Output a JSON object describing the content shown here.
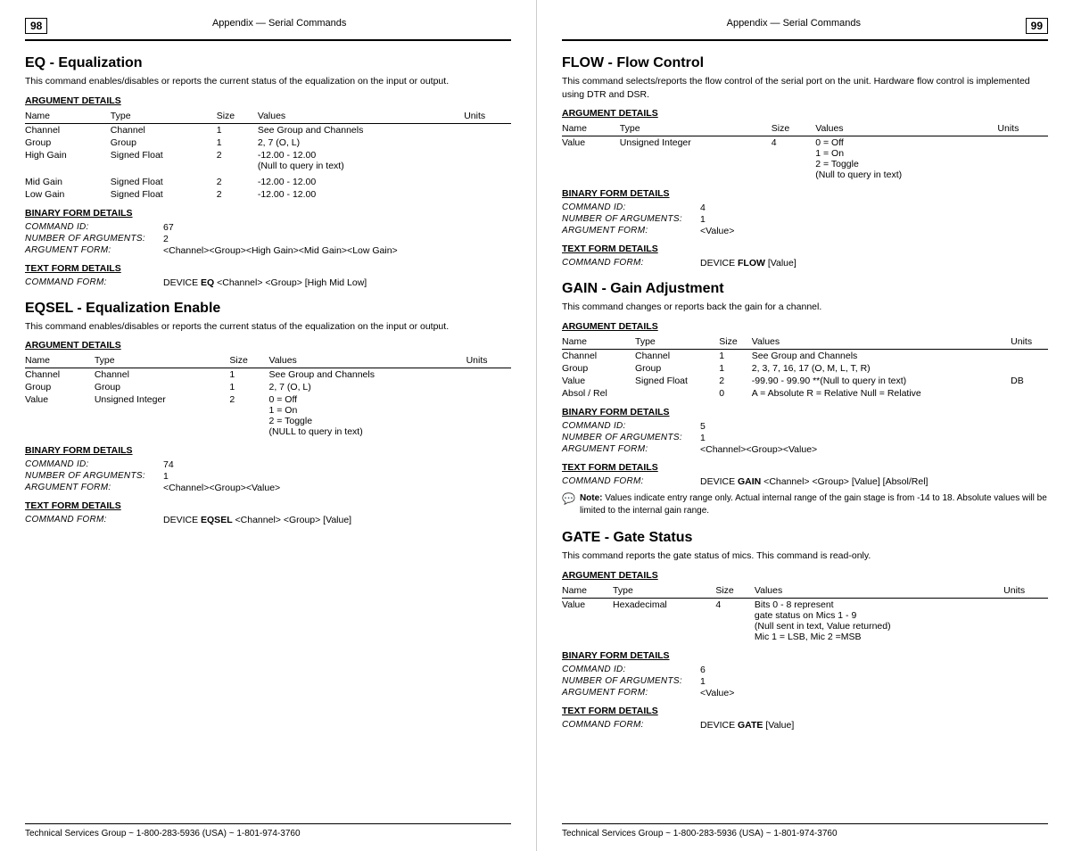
{
  "pages": {
    "left": {
      "page_num": "98",
      "header": "Appendix — Serial Commands",
      "footer": "Technical Services Group ~ 1-800-283-5936 (USA) ~ 1-801-974-3760",
      "sections": [
        {
          "id": "eq",
          "title": "EQ - Equalization",
          "desc": "This command enables/disables or reports the current status of the equalization on the input or output.",
          "argument_details_label": "ARGUMENT DETAILS",
          "table_headers": [
            "Name",
            "Type",
            "Size",
            "Values",
            "Units"
          ],
          "table_rows": [
            [
              "Channel",
              "Channel",
              "1",
              "See Group and Channels",
              ""
            ],
            [
              "Group",
              "Group",
              "1",
              "2, 7 (O, L)",
              ""
            ],
            [
              "High Gain",
              "Signed Float",
              "2",
              "-12.00 - 12.00\n(Null to query in text)",
              ""
            ],
            [
              "Mid Gain",
              "Signed Float",
              "2",
              "-12.00 - 12.00",
              ""
            ],
            [
              "Low Gain",
              "Signed Float",
              "2",
              "-12.00 - 12.00",
              ""
            ]
          ],
          "binary_details_label": "BINARY FORM DETAILS",
          "binary": {
            "command_id_label": "COMMAND ID:",
            "command_id": "67",
            "num_args_label": "NUMBER OF ARGUMENTS:",
            "num_args": "2",
            "arg_form_label": "ARGUMENT FORM:",
            "arg_form": "<Channel><Group><High Gain><Mid Gain><Low Gain>"
          },
          "text_details_label": "TEXT FORM DETAILS",
          "text": {
            "cmd_form_label": "COMMAND FORM:",
            "cmd_form_prefix": "DEVICE ",
            "cmd_form_bold": "EQ",
            "cmd_form_suffix": " <Channel> <Group> [High Mid Low]"
          }
        },
        {
          "id": "eqsel",
          "title": "EQSEL - Equalization Enable",
          "desc": "This command enables/disables or reports the current status of the equalization on the input or output.",
          "argument_details_label": "ARGUMENT DETAILS",
          "table_headers": [
            "Name",
            "Type",
            "Size",
            "Values",
            "Units"
          ],
          "table_rows": [
            [
              "Channel",
              "Channel",
              "1",
              "See Group and Channels",
              ""
            ],
            [
              "Group",
              "Group",
              "1",
              "2, 7 (O, L)",
              ""
            ],
            [
              "Value",
              "Unsigned Integer",
              "2",
              "0 = Off\n1 = On\n2 = Toggle\n(NULL to query in text)",
              ""
            ]
          ],
          "binary_details_label": "BINARY FORM DETAILS",
          "binary": {
            "command_id_label": "COMMAND ID:",
            "command_id": "74",
            "num_args_label": "NUMBER OF ARGUMENTS:",
            "num_args": "1",
            "arg_form_label": "ARGUMENT FORM:",
            "arg_form": "<Channel><Group><Value>"
          },
          "text_details_label": "TEXT FORM DETAILS",
          "text": {
            "cmd_form_label": "COMMAND FORM:",
            "cmd_form_prefix": "DEVICE ",
            "cmd_form_bold": "EQSEL",
            "cmd_form_suffix": " <Channel> <Group> [Value]"
          }
        }
      ]
    },
    "right": {
      "page_num": "99",
      "header": "Appendix — Serial Commands",
      "footer": "Technical Services Group ~ 1-800-283-5936 (USA) ~ 1-801-974-3760",
      "sections": [
        {
          "id": "flow",
          "title": "FLOW - Flow Control",
          "desc": "This command selects/reports the flow control of the serial port on the unit. Hardware flow control is implemented using DTR and DSR.",
          "argument_details_label": "ARGUMENT DETAILS",
          "table_headers": [
            "Name",
            "Type",
            "Size",
            "Values",
            "Units"
          ],
          "table_rows": [
            [
              "Value",
              "Unsigned Integer",
              "4",
              "0 = Off\n1 = On\n2 = Toggle\n(Null to query in text)",
              ""
            ]
          ],
          "binary_details_label": "BINARY FORM DETAILS",
          "binary": {
            "command_id_label": "COMMAND ID:",
            "command_id": "4",
            "num_args_label": "NUMBER OF ARGUMENTS:",
            "num_args": "1",
            "arg_form_label": "ARGUMENT FORM:",
            "arg_form": "<Value>"
          },
          "text_details_label": "TEXT FORM DETAILS",
          "text": {
            "cmd_form_label": "COMMAND FORM:",
            "cmd_form_prefix": "DEVICE ",
            "cmd_form_bold": "FLOW",
            "cmd_form_suffix": " [Value]"
          }
        },
        {
          "id": "gain",
          "title": "GAIN - Gain Adjustment",
          "desc": "This command changes or reports back the gain for a channel.",
          "argument_details_label": "ARGUMENT DETAILS",
          "table_headers": [
            "Name",
            "Type",
            "Size",
            "Values",
            "Units"
          ],
          "table_rows": [
            [
              "Channel",
              "Channel",
              "1",
              "See Group and Channels",
              ""
            ],
            [
              "Group",
              "Group",
              "1",
              "2, 3, 7, 16, 17 (O, M, L, T, R)",
              ""
            ],
            [
              "Value",
              "Signed Float",
              "2",
              "-99.90 - 99.90 **(Null to query in text)",
              "DB"
            ],
            [
              "Absol / Rel",
              "",
              "0",
              "A = Absolute R = Relative Null = Relative",
              ""
            ]
          ],
          "binary_details_label": "BINARY FORM DETAILS",
          "binary": {
            "command_id_label": "COMMAND ID:",
            "command_id": "5",
            "num_args_label": "NUMBER OF ARGUMENTS:",
            "num_args": "1",
            "arg_form_label": "ARGUMENT FORM:",
            "arg_form": "<Channel><Group><Value>"
          },
          "text_details_label": "TEXT FORM DETAILS",
          "text": {
            "cmd_form_label": "COMMAND FORM:",
            "cmd_form_prefix": "DEVICE ",
            "cmd_form_bold": "GAIN",
            "cmd_form_suffix": " <Channel> <Group> [Value] [Absol/Rel]"
          },
          "note": "Note: Values indicate entry range only. Actual internal range of the gain stage is from -14 to 18. Absolute values will be limited to the internal gain range."
        },
        {
          "id": "gate",
          "title": "GATE - Gate Status",
          "desc": "This command reports the gate status of mics. This command is read-only.",
          "argument_details_label": "ARGUMENT DETAILS",
          "table_headers": [
            "Name",
            "Type",
            "Size",
            "Values",
            "Units"
          ],
          "table_rows": [
            [
              "Value",
              "Hexadecimal",
              "4",
              "Bits 0 - 8 represent\ngate status on Mics 1 - 9\n(Null sent in text, Value returned)\nMic 1 = LSB, Mic 2 =MSB",
              ""
            ]
          ],
          "binary_details_label": "BINARY FORM DETAILS",
          "binary": {
            "command_id_label": "COMMAND ID:",
            "command_id": "6",
            "num_args_label": "NUMBER OF ARGUMENTS:",
            "num_args": "1",
            "arg_form_label": "ARGUMENT FORM:",
            "arg_form": "<Value>"
          },
          "text_details_label": "TEXT FORM DETAILS",
          "text": {
            "cmd_form_label": "COMMAND FORM:",
            "cmd_form_prefix": "DEVICE ",
            "cmd_form_bold": "GATE",
            "cmd_form_suffix": " [Value]"
          }
        }
      ]
    }
  }
}
